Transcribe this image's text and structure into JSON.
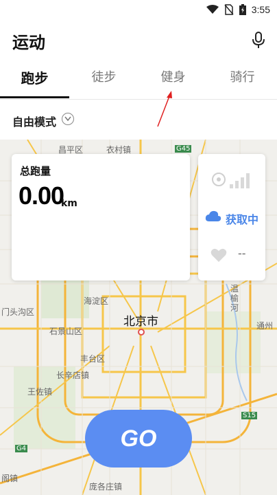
{
  "status_bar": {
    "time": "3:55",
    "icons": [
      "wifi-icon",
      "no-sim-icon",
      "battery-charging-icon"
    ]
  },
  "header": {
    "title": "运动",
    "mic_icon": "microphone-icon"
  },
  "tabs": [
    {
      "label": "跑步",
      "active": true
    },
    {
      "label": "徒步",
      "active": false
    },
    {
      "label": "健身",
      "active": false
    },
    {
      "label": "骑行",
      "active": false
    }
  ],
  "mode": {
    "label": "自由模式",
    "icon": "chevron-down-circle-icon"
  },
  "map": {
    "city": "北京市",
    "labels": [
      {
        "text": "昌平区"
      },
      {
        "text": "衣村镇"
      },
      {
        "text": "G45"
      },
      {
        "text": "门头沟区"
      },
      {
        "text": "海淀区"
      },
      {
        "text": "石景山区"
      },
      {
        "text": "丰台区"
      },
      {
        "text": "王佐镇"
      },
      {
        "text": "长辛店镇"
      },
      {
        "text": "温榆河"
      },
      {
        "text": "通州"
      },
      {
        "text": "S15"
      },
      {
        "text": "G4"
      },
      {
        "text": "庞各庄镇"
      },
      {
        "text": "阁镇"
      }
    ]
  },
  "run_card": {
    "label": "总跑量",
    "value": "0.00",
    "unit": "km"
  },
  "side_card": {
    "gps_icon": "gps-signal-icon",
    "cloud_icon": "cloud-icon",
    "status_text": "获取中",
    "heart_icon": "heart-icon",
    "heart_rate": "--"
  },
  "go_button": {
    "label": "GO",
    "color": "#5b8df2"
  },
  "colors": {
    "accent": "#4a86e8",
    "annotation": "#e02020"
  }
}
